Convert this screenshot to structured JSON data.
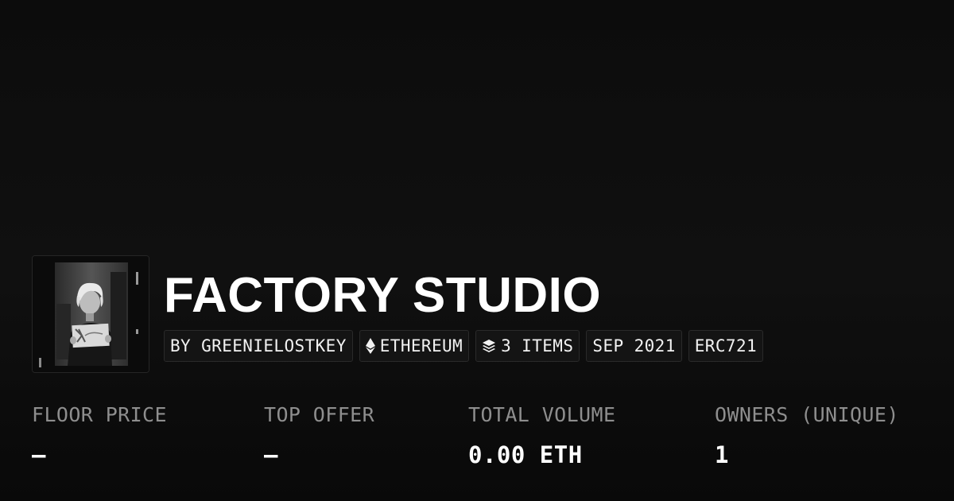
{
  "collection": {
    "title": "FACTORY STUDIO",
    "thumbnail_icon": "film-contact-print-image"
  },
  "badges": [
    {
      "label": "BY GREENIELOSTKEY",
      "icon": ""
    },
    {
      "label": "ETHEREUM",
      "icon": "ethereum-icon"
    },
    {
      "label": "3 ITEMS",
      "icon": "layers-icon"
    },
    {
      "label": "SEP 2021",
      "icon": ""
    },
    {
      "label": "ERC721",
      "icon": ""
    }
  ],
  "stats": [
    {
      "label": "FLOOR PRICE",
      "value": "–"
    },
    {
      "label": "TOP OFFER",
      "value": "–"
    },
    {
      "label": "TOTAL VOLUME",
      "value": "0.00 ETH"
    },
    {
      "label": "OWNERS (UNIQUE)",
      "value": "1"
    }
  ],
  "colors": {
    "background": "#0c0c0c",
    "text_primary": "#ffffff",
    "text_muted": "#8e8e8e",
    "badge_background": "#141414",
    "badge_border": "#2a2a2a"
  }
}
